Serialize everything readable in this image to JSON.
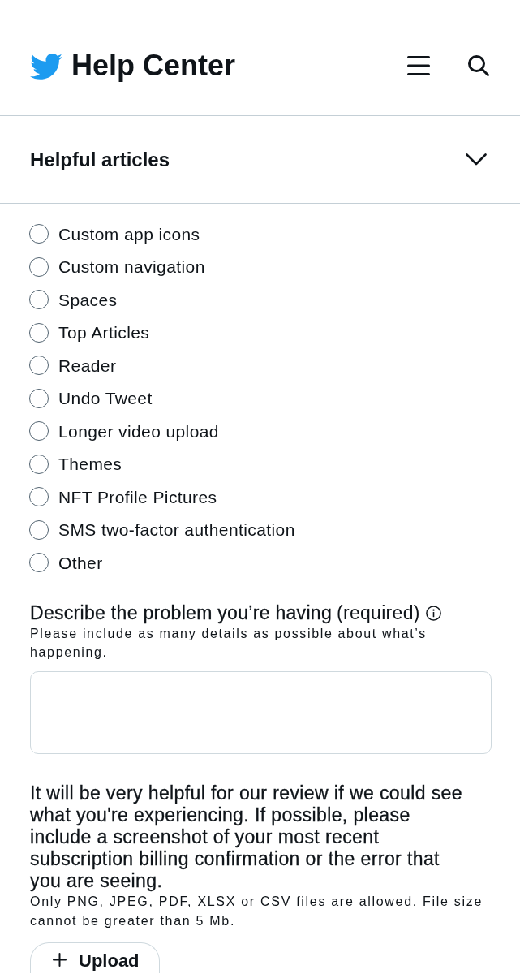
{
  "header": {
    "title": "Help Center"
  },
  "helpful_articles": {
    "title": "Helpful articles",
    "expanded": false
  },
  "topic_options": [
    {
      "label": "Custom app icons",
      "selected": false
    },
    {
      "label": "Custom navigation",
      "selected": false
    },
    {
      "label": "Spaces",
      "selected": false
    },
    {
      "label": "Top Articles",
      "selected": false
    },
    {
      "label": "Reader",
      "selected": false
    },
    {
      "label": "Undo Tweet",
      "selected": false
    },
    {
      "label": "Longer video upload",
      "selected": false
    },
    {
      "label": "Themes",
      "selected": false
    },
    {
      "label": "NFT Profile Pictures",
      "selected": false
    },
    {
      "label": "SMS two-factor authentication",
      "selected": false
    },
    {
      "label": "Other",
      "selected": false
    }
  ],
  "problem_field": {
    "label": "Describe the problem you’re having",
    "required_note": "(required)",
    "hint": "Please include as many details as possible about what’s happening."
  },
  "attachment": {
    "prompt": "It will be very helpful for our review if we could see what you're experiencing. If possible, please include a screenshot of your most recent subscription billing confirmation or the error that you are seeing.",
    "file_rules": "Only PNG, JPEG, PDF, XLSX or CSV files are allowed. File size cannot be greater than 5 Mb.",
    "upload_button": "Upload"
  }
}
